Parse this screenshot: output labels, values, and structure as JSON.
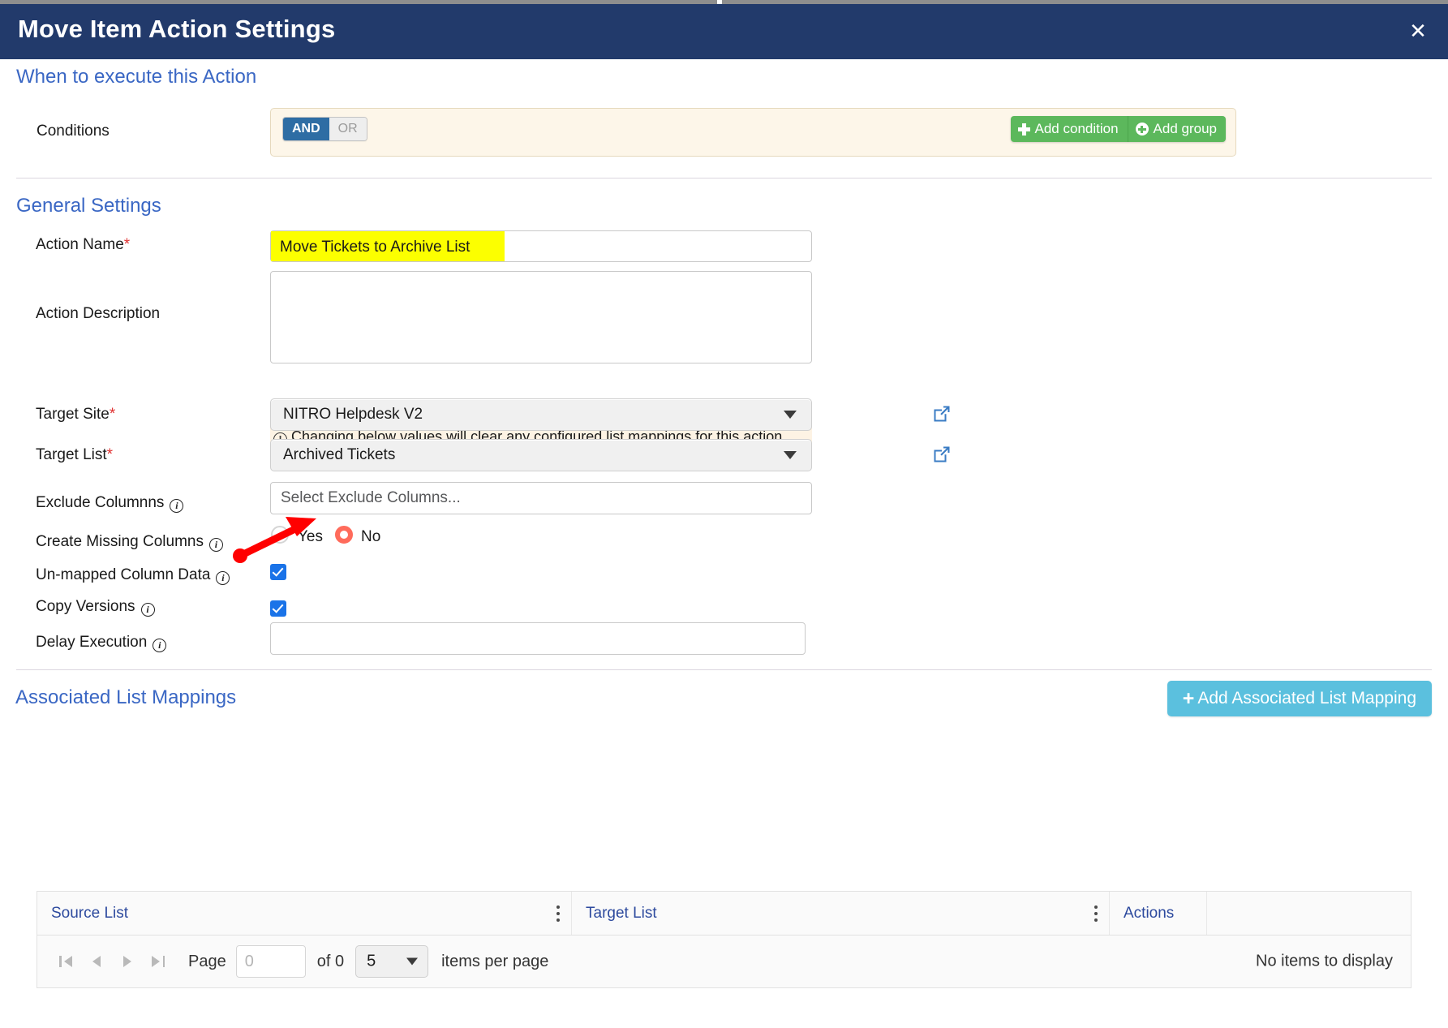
{
  "dialog": {
    "title": "Move Item Action Settings",
    "close_label": "✕"
  },
  "when_section": {
    "heading": "When to execute this Action",
    "conditions_label": "Conditions",
    "operator_and": "AND",
    "operator_or": "OR",
    "selected_operator": "AND",
    "add_condition_label": "Add condition",
    "add_group_label": "Add group"
  },
  "general_section": {
    "heading": "General Settings",
    "action_name_label": "Action Name",
    "action_name_value": "Move Tickets to Archive List",
    "action_description_label": "Action Description",
    "action_description_value": "",
    "warning_text": "Changing below values will clear any configured list mappings for this action",
    "target_site_label": "Target Site",
    "target_site_value": "NITRO Helpdesk V2",
    "target_list_label": "Target List",
    "target_list_value": "Archived Tickets",
    "exclude_columns_label": "Exclude Columnns",
    "exclude_columns_placeholder": "Select Exclude Columns...",
    "exclude_columns_value": "",
    "create_missing_columns_label": "Create Missing Columns",
    "radio_yes_label": "Yes",
    "radio_no_label": "No",
    "create_missing_columns_selected": "No",
    "unmapped_column_data_label": "Un-mapped Column Data",
    "unmapped_column_data_checked": true,
    "copy_versions_label": "Copy Versions",
    "copy_versions_checked": true,
    "delay_execution_label": "Delay Execution",
    "delay_execution_value": "",
    "required_marker": "*",
    "info_glyph": "i"
  },
  "mappings_section": {
    "heading": "Associated List Mappings",
    "add_mapping_label": "Add Associated List Mapping",
    "add_mapping_plus": "+",
    "columns": [
      "Source List",
      "Target List",
      "Actions"
    ],
    "rows": [],
    "empty_text": "No items to display",
    "pager": {
      "page_label": "Page",
      "page_value": "",
      "page_placeholder": "0",
      "of_label": "of 0",
      "page_size": "5",
      "items_per_page_label": "items per page"
    }
  },
  "colors": {
    "header_bg": "#223a6b",
    "section_heading": "#3a67c4",
    "accent_green": "#5cb85c",
    "accent_cyan": "#5bc0de",
    "and_blue": "#2e6da4",
    "radio_selected": "#ff6b5b",
    "checkbox_blue": "#1a73e8",
    "highlight_yellow": "#fcff00",
    "warning_bg": "#fdf3e4",
    "conditions_bg": "#fdf6e9",
    "annotation_red": "#ff0000"
  }
}
